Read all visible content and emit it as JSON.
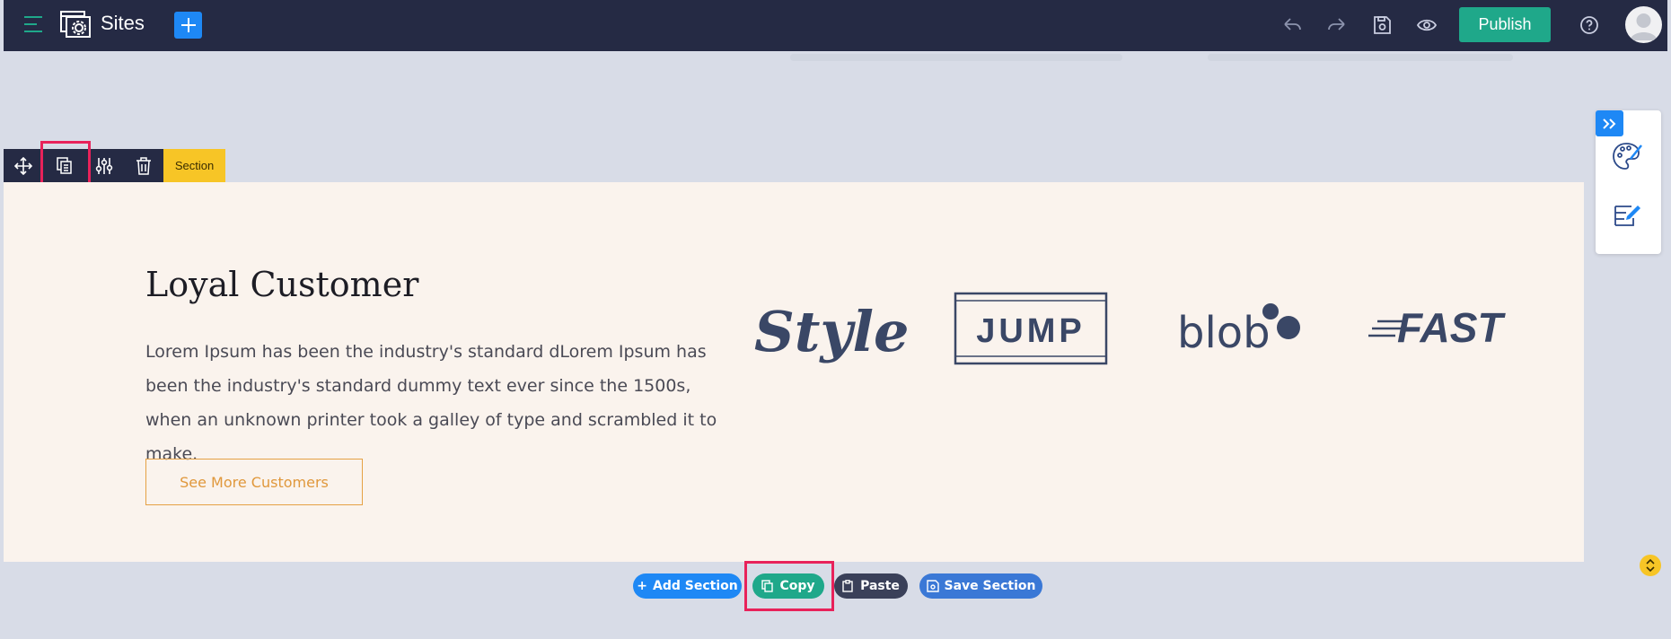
{
  "header": {
    "title": "Sites",
    "publish_label": "Publish"
  },
  "section_toolbar": {
    "tag_label": "Section"
  },
  "section": {
    "heading": "Loyal Customer",
    "body": "Lorem Ipsum has been the industry's standard dLorem Ipsum has been the industry's standard dummy text ever since the 1500s, when an unknown printer took a galley of type and scrambled it to make.",
    "button_label": "See More Customers",
    "logos": [
      "Style",
      "JUMP",
      "blob",
      "FAST"
    ]
  },
  "bottom_actions": {
    "add_section": "Add Section",
    "copy": "Copy",
    "paste": "Paste",
    "save_section": "Save Section"
  },
  "colors": {
    "topbar": "#252a44",
    "accent_blue": "#1e88f5",
    "publish_green": "#1fa88a",
    "section_tag_yellow": "#f7c526",
    "highlight_pink": "#e8225a",
    "logo_navy": "#3a4766"
  }
}
